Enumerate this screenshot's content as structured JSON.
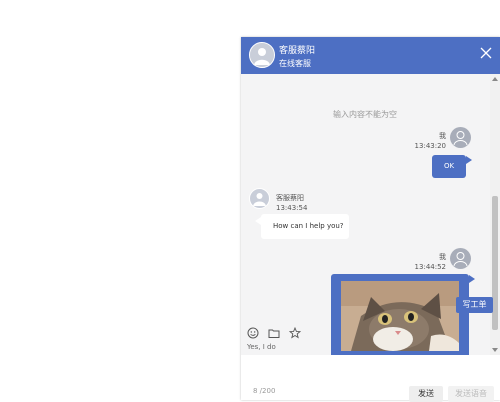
{
  "header": {
    "agent_name": "客服蔡阳",
    "status": "在线客服"
  },
  "messages": {
    "hint": "输入内容不能为空",
    "m1": {
      "sender": "我",
      "time": "13:43:20",
      "text": "OK"
    },
    "m2": {
      "sender": "客服蔡阳",
      "time": "13:43:54",
      "text": "How can I help you?"
    },
    "m3": {
      "sender": "我",
      "time": "13:44:52"
    }
  },
  "side_button": {
    "label": "写工单"
  },
  "composer": {
    "text": "Yes, I do",
    "counter": "8 /200",
    "send_label": "发送",
    "voice_label": "发送语音"
  },
  "colors": {
    "accent": "#4d6fc3"
  },
  "icons": [
    "close-icon",
    "emoji-icon",
    "folder-icon",
    "star-icon",
    "user-avatar-icon"
  ]
}
